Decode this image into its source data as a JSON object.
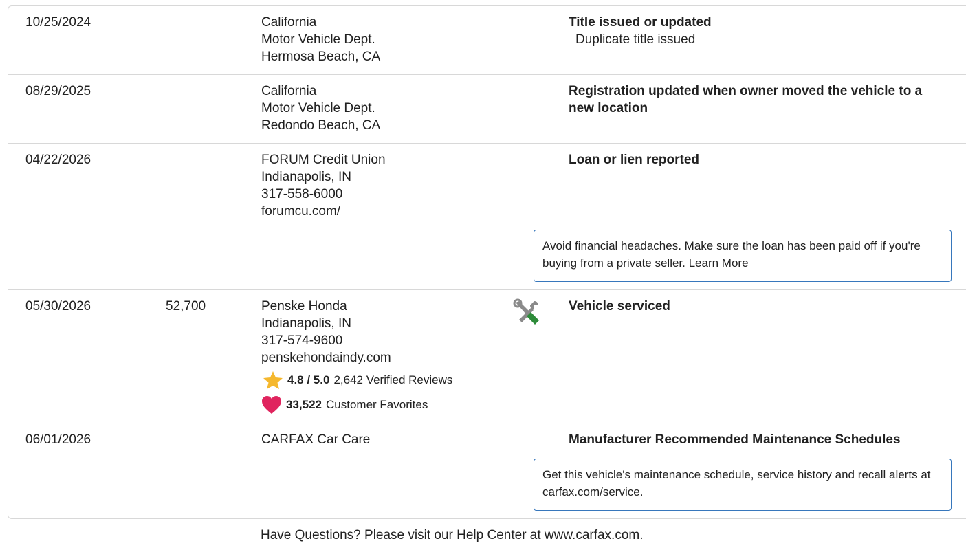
{
  "rows": [
    {
      "date": "10/25/2024",
      "odometer": "",
      "source": [
        "California",
        "Motor Vehicle Dept.",
        "Hermosa Beach, CA"
      ],
      "headline": "Title issued or updated",
      "detail": "Duplicate title issued"
    },
    {
      "date": "08/29/2025",
      "odometer": "",
      "source": [
        "California",
        "Motor Vehicle Dept.",
        "Redondo Beach, CA"
      ],
      "headline": "Registration updated when owner moved the vehicle to a new location"
    },
    {
      "date": "04/22/2026",
      "odometer": "",
      "source": [
        "FORUM Credit Union",
        "Indianapolis, IN",
        "317-558-6000",
        "forumcu.com/"
      ],
      "headline": "Loan or lien reported",
      "callout": "Avoid financial headaches. Make sure the loan has been paid off if you're buying from a private seller. Learn More"
    },
    {
      "date": "05/30/2026",
      "odometer": "52,700",
      "source": [
        "Penske Honda",
        "Indianapolis, IN",
        "317-574-9600",
        "penskehondaindy.com"
      ],
      "rating": {
        "score": "4.8 / 5.0",
        "reviews": "2,642 Verified Reviews"
      },
      "favorites": {
        "count": "33,522",
        "label": "Customer Favorites"
      },
      "icon": "service-tools-icon",
      "headline": "Vehicle serviced"
    },
    {
      "date": "06/01/2026",
      "odometer": "",
      "source": [
        "CARFAX Car Care"
      ],
      "headline": "Manufacturer Recommended Maintenance Schedules",
      "callout": "Get this vehicle's maintenance schedule, service history and recall alerts at carfax.com/service."
    }
  ],
  "icons": {
    "star": "star-icon",
    "heart": "heart-icon"
  },
  "colors": {
    "star": "#f5b82e",
    "heart": "#e0245e",
    "callout_border": "#3777bc",
    "wrench_green": "#2e8b3a"
  },
  "footer": "Have Questions? Please visit our Help Center at www.carfax.com."
}
